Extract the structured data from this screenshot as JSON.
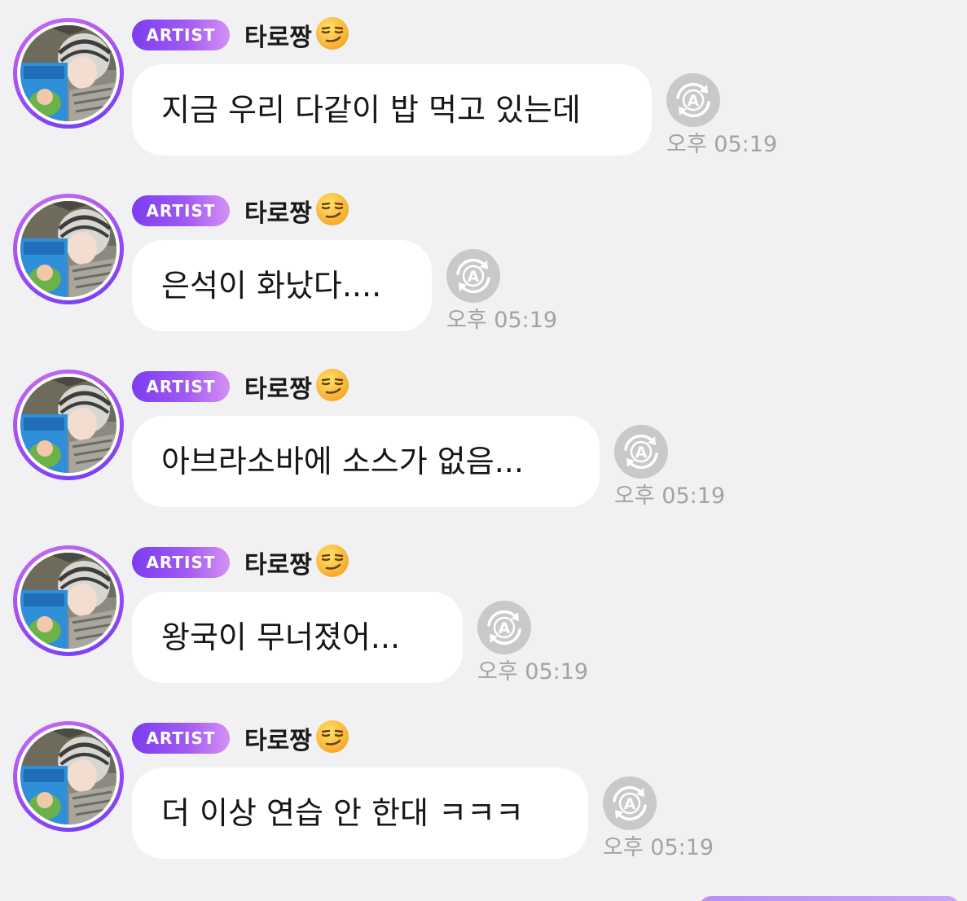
{
  "colors": {
    "background": "#f1f0f2",
    "bubble": "#ffffff",
    "badge_gradient_start": "#7a3df0",
    "badge_gradient_end": "#d48ff6",
    "timestamp": "#a3a3a3",
    "translate_icon": "#c9c9c9"
  },
  "icons": {
    "translate": "circular-arrows-letter-a",
    "emoji": "smirking-face"
  },
  "icon_letter": "A",
  "messages": [
    {
      "badge": "ARTIST",
      "sender": "타로짱",
      "text": "지금 우리 다같이 밥 먹고 있는데",
      "time": "오후 05:19"
    },
    {
      "badge": "ARTIST",
      "sender": "타로짱",
      "text": "은석이 화났다....",
      "time": "오후 05:19"
    },
    {
      "badge": "ARTIST",
      "sender": "타로짱",
      "text": "아브라소바에 소스가 없음...",
      "time": "오후 05:19"
    },
    {
      "badge": "ARTIST",
      "sender": "타로짱",
      "text": "왕국이 무너졌어...",
      "time": "오후 05:19"
    },
    {
      "badge": "ARTIST",
      "sender": "타로짱",
      "text": "더 이상 연습 안 한대 ㅋㅋㅋ",
      "time": "오후 05:19"
    }
  ]
}
